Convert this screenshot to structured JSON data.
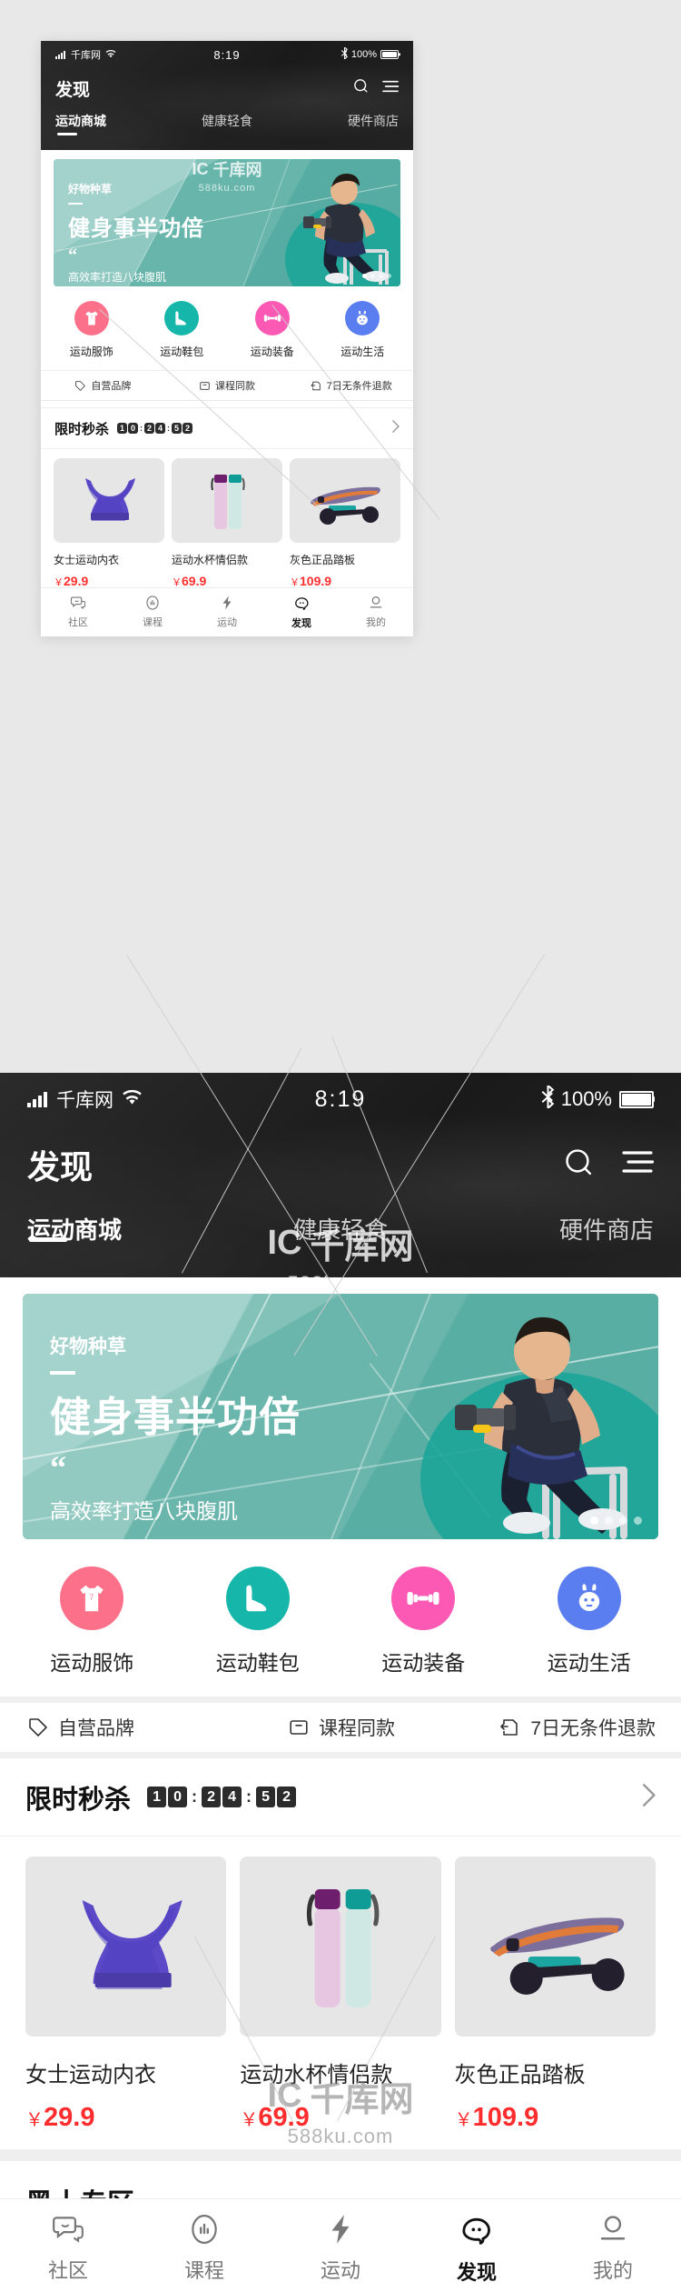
{
  "statusbar": {
    "carrier": "千库网",
    "time": "8:19",
    "battery_text": "100%",
    "signal_icon": "signal-bars-icon",
    "wifi_icon": "wifi-icon",
    "bluetooth_icon": "bluetooth-icon",
    "battery_icon": "battery-full-icon"
  },
  "header": {
    "title": "发现",
    "search_icon": "search-icon",
    "menu_icon": "menu-icon",
    "tabs": [
      {
        "label": "运动商城",
        "active": true
      },
      {
        "label": "健康轻食",
        "active": false
      },
      {
        "label": "硬件商店",
        "active": false
      }
    ]
  },
  "banner": {
    "kicker": "好物种草",
    "headline": "健身事半功倍",
    "quote_mark": "“",
    "subtitle": "高效率打造八块腹肌",
    "dots_total": 4,
    "dots_active_index": 0,
    "bg_color": "#6cb6ad",
    "accent_color": "#17a498"
  },
  "categories": [
    {
      "label": "运动服饰",
      "icon": "tshirt-icon",
      "color": "#fc7189"
    },
    {
      "label": "运动鞋包",
      "icon": "sneaker-icon",
      "color": "#17b6ab"
    },
    {
      "label": "运动装备",
      "icon": "dumbbell-icon",
      "color": "#fb59b4"
    },
    {
      "label": "运动生活",
      "icon": "rabbit-icon",
      "color": "#5a7df0"
    }
  ],
  "services": [
    {
      "label": "自营品牌",
      "icon": "tag-icon"
    },
    {
      "label": "课程同款",
      "icon": "ticket-icon"
    },
    {
      "label": "7日无条件退款",
      "icon": "return-icon"
    }
  ],
  "seckill": {
    "title": "限时秒杀",
    "countdown": {
      "hours": [
        "1",
        "0"
      ],
      "minutes": [
        "2",
        "4"
      ],
      "seconds": [
        "5",
        "2"
      ],
      "separator": ":"
    },
    "arrow_icon": "chevron-right-icon"
  },
  "products": [
    {
      "name": "女士运动内衣",
      "currency": "￥",
      "price": "29.9",
      "image": "sports-bra-image"
    },
    {
      "name": "运动水杯情侣款",
      "currency": "￥",
      "price": "69.9",
      "image": "water-bottles-image"
    },
    {
      "name": "灰色正品踏板",
      "currency": "￥",
      "price": "109.9",
      "image": "skateboard-image"
    }
  ],
  "next_section": {
    "title": "黑十专区"
  },
  "tabbar": [
    {
      "label": "社区",
      "icon": "community-icon",
      "active": false
    },
    {
      "label": "课程",
      "icon": "course-icon",
      "active": false
    },
    {
      "label": "运动",
      "icon": "bolt-icon",
      "active": false
    },
    {
      "label": "发现",
      "icon": "discover-icon",
      "active": true
    },
    {
      "label": "我的",
      "icon": "user-icon",
      "active": false
    }
  ],
  "watermark": {
    "brand": "千库网",
    "site": "588ku.com"
  },
  "price_color": "#ff2d2d"
}
